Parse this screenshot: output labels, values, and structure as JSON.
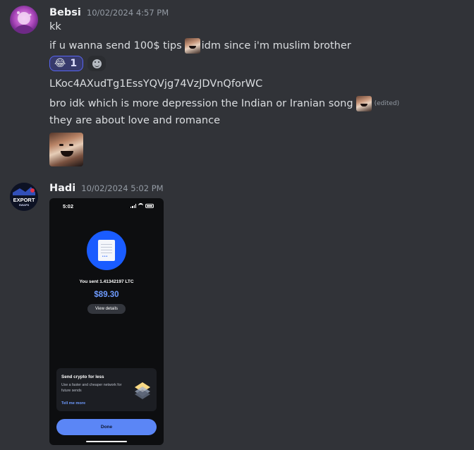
{
  "messages": [
    {
      "username": "Bebsi",
      "timestamp": "10/02/2024 4:57 PM",
      "lines": {
        "l1": "kk",
        "l2a": "if u wanna send 100$ tips",
        "l2b": "idm since i'm muslim brother",
        "l3": "LKoc4AXudTg1EssYQVjg74VzJDVnQforWC",
        "l4": "bro idk which is more depression the Indian or Iranian song",
        "l4_edited": "(edited)",
        "l5": "they are about love and romance"
      },
      "reaction": {
        "emoji": "😂",
        "count": "1"
      }
    },
    {
      "username": "Hadi",
      "timestamp": "10/02/2024 5:02 PM",
      "avatar_text": {
        "top": "EXPORT",
        "bottom": "SWAPS"
      },
      "screenshot": {
        "time": "5:02",
        "sent_text": "You sent 1.41342197 LTC",
        "amount": "$89.30",
        "view_details": "View details",
        "card_title": "Send crypto for less",
        "card_body": "Use a faster and cheaper network for future sends",
        "card_link": "Tell me more",
        "done": "Done"
      }
    }
  ],
  "colors": {
    "background": "#313338",
    "username": "#f2f3f5",
    "timestamp": "#949ba4",
    "text": "#dbdee1",
    "reaction_border": "#5865f2",
    "coinbase_blue": "#1a5cff"
  },
  "icons": [
    "custom-laughing-man-emoji",
    "add-reaction-smiley-icon",
    "document-icon",
    "layers-icon",
    "wifi-icon",
    "battery-icon",
    "signal-icon"
  ]
}
